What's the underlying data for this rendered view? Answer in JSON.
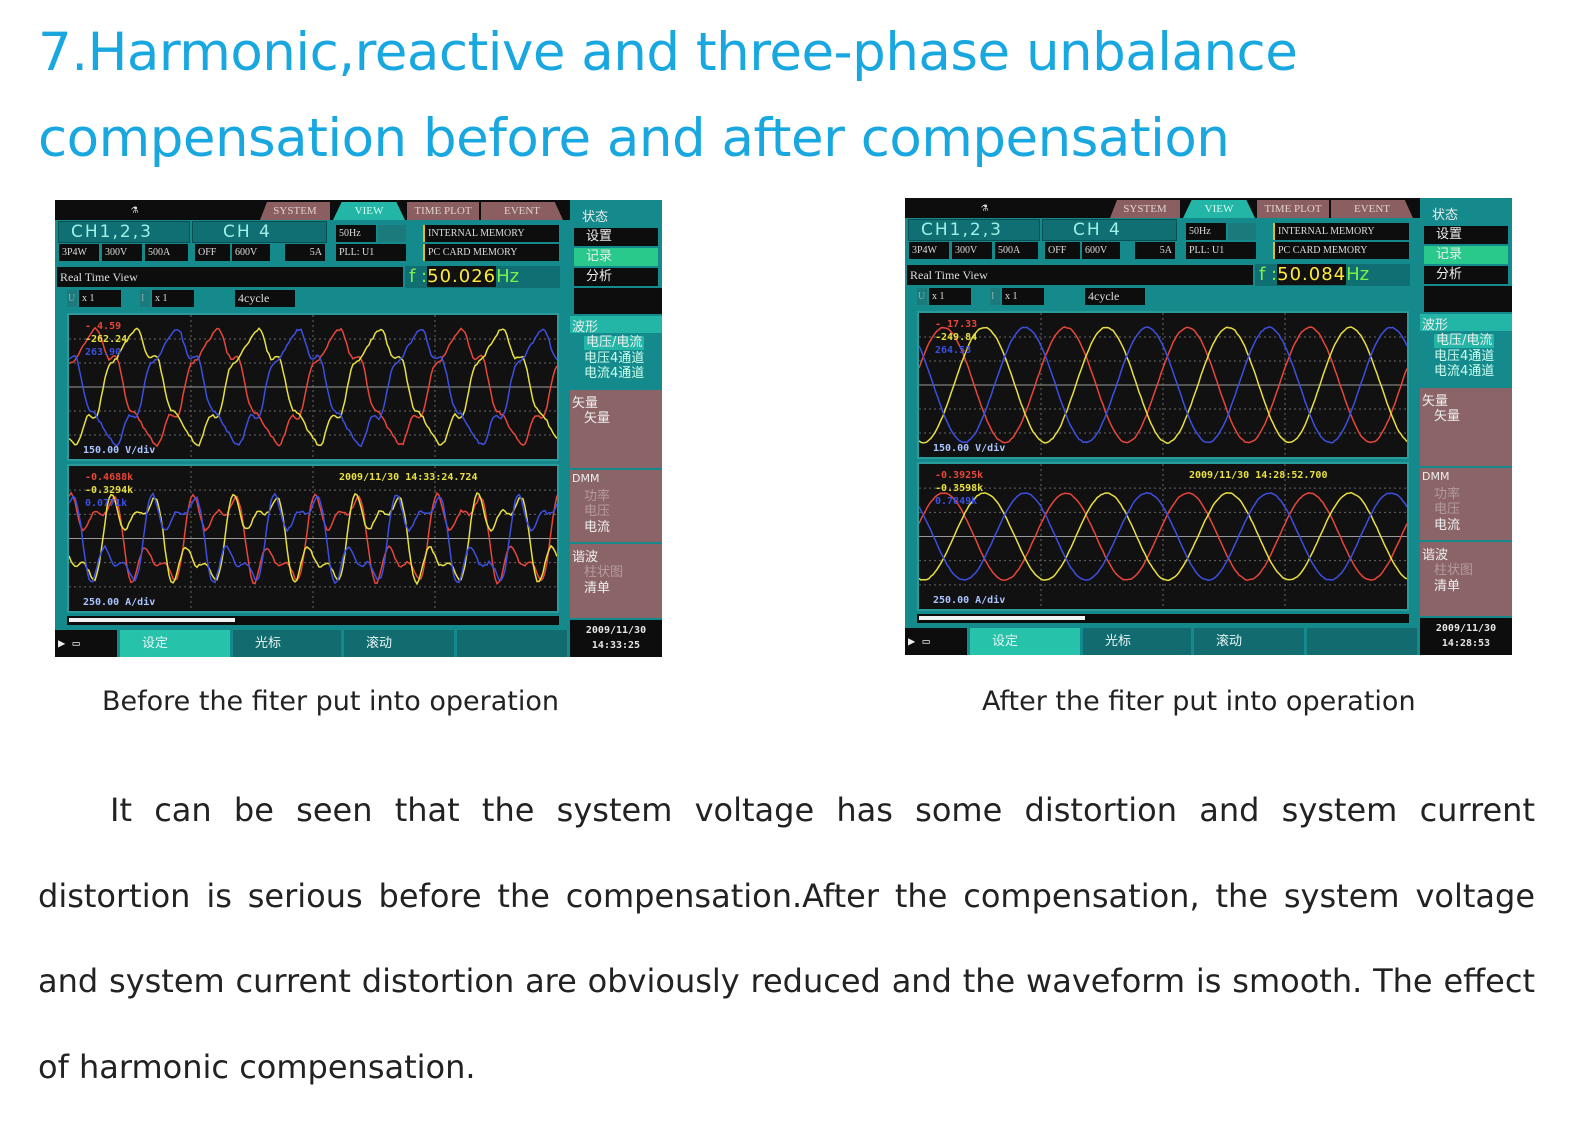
{
  "title": {
    "line1": "7.Harmonic,reactive and three-phase unbalance",
    "line2": "compensation before and after compensation"
  },
  "colors": {
    "title": "#19a7e0",
    "screen_bg": "#148a8c",
    "phase_a": "#e8463a",
    "phase_b": "#e8e040",
    "phase_c": "#3d4fe0"
  },
  "screens": [
    {
      "caption": "Before the fiter put into operation",
      "waveform_style": "distorted",
      "tabs": [
        "SYSTEM",
        "VIEW",
        "TIME PLOT",
        "EVENT"
      ],
      "ch123": "CH1,2,3",
      "ch4": "CH 4",
      "wiring": "3P4W",
      "u_range": "300V",
      "i_range": "500A",
      "ch4_state": "OFF",
      "ch4_u": "600V",
      "ch4_i": "5A",
      "freq_setting": "50Hz",
      "pll": "PLL: U1",
      "mem_internal": "INTERNAL MEMORY",
      "mem_card": "PC CARD  MEMORY",
      "view_name": "Real Time View",
      "freq_label": "f :",
      "freq_value": "50.026",
      "freq_unit": "Hz",
      "u_label": "U",
      "u_zoom": "x 1",
      "i_label": "I",
      "i_zoom": "x 1",
      "cycles": "4cycle",
      "v_readings": [
        "- 4.59",
        "-262.24",
        "263.90"
      ],
      "v_scale": "150.00 V/div",
      "i_readings": [
        "-0.4688k",
        "-0.3294k",
        "0.0771k"
      ],
      "i_timestamp": "2009/11/30 14:33:24.724",
      "i_scale": "250.00 A/div",
      "scroll_fraction": 0.34,
      "side": {
        "status": "状态",
        "setup": "设置",
        "record": "记录",
        "analysis": "分析",
        "waveform": "波形",
        "wave_items": [
          "电压/电流",
          "电压4通道",
          "电流4通道"
        ],
        "vector": "矢量",
        "vector_item": "矢量",
        "dmm": "DMM",
        "dmm_items": [
          "功率",
          "电压",
          "电流"
        ],
        "harmonic": "谐波",
        "harmonic_items": [
          "柱状图",
          "清单"
        ]
      },
      "bottom": {
        "setup": "设定",
        "cursor": "光标",
        "scroll": "滚动"
      },
      "date": "2009/11/30",
      "time": "14:33:25"
    },
    {
      "caption": "After the fiter put into operation",
      "waveform_style": "smooth",
      "tabs": [
        "SYSTEM",
        "VIEW",
        "TIME PLOT",
        "EVENT"
      ],
      "ch123": "CH1,2,3",
      "ch4": "CH 4",
      "wiring": "3P4W",
      "u_range": "300V",
      "i_range": "500A",
      "ch4_state": "OFF",
      "ch4_u": "600V",
      "ch4_i": "5A",
      "freq_setting": "50Hz",
      "pll": "PLL: U1",
      "mem_internal": "INTERNAL MEMORY",
      "mem_card": "PC CARD  MEMORY",
      "view_name": "Real Time View",
      "freq_label": "f :",
      "freq_value": "50.084",
      "freq_unit": "Hz",
      "u_label": "U",
      "u_zoom": "x 1",
      "i_label": "I",
      "i_zoom": "x 1",
      "cycles": "4cycle",
      "v_readings": [
        "- 17.33",
        "-249.84",
        "264.53"
      ],
      "v_scale": "150.00 V/div",
      "i_readings": [
        "-0.3925k",
        "-0.3598k",
        "0.7849k"
      ],
      "i_timestamp": "2009/11/30 14:28:52.700",
      "i_scale": "250.00 A/div",
      "scroll_fraction": 0.34,
      "side": {
        "status": "状态",
        "setup": "设置",
        "record": "记录",
        "analysis": "分析",
        "waveform": "波形",
        "wave_items": [
          "电压/电流",
          "电压4通道",
          "电流4通道"
        ],
        "vector": "矢量",
        "vector_item": "矢量",
        "dmm": "DMM",
        "dmm_items": [
          "功率",
          "电压",
          "电流"
        ],
        "harmonic": "谐波",
        "harmonic_items": [
          "柱状图",
          "清单"
        ]
      },
      "bottom": {
        "setup": "设定",
        "cursor": "光标",
        "scroll": "滚动"
      },
      "date": "2009/11/30",
      "time": "14:28:53"
    }
  ],
  "paragraph": "It can be seen that the system voltage has some distortion and system current distortion is serious before the compensation.After the compensation, the system voltage and system current distortion are obviously reduced and the waveform is smooth. The effect of harmonic compensation."
}
